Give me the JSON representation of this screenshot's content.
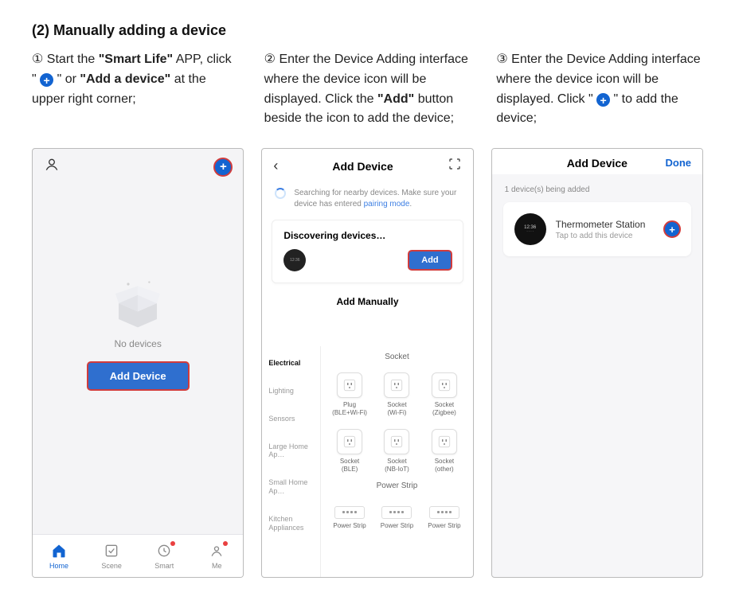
{
  "section_title": "(2) Manually adding a device",
  "steps": {
    "s1": {
      "num": "①",
      "t1": "Start the ",
      "b1": "\"Smart Life\"",
      "t2": " APP, click \" ",
      "t3": " \" or ",
      "b2": "\"Add a device\"",
      "t4": " at the upper right corner;"
    },
    "s2": {
      "num": "②",
      "t1": "Enter the Device Adding interface where the device icon will be displayed. Click the ",
      "b1": "\"Add\"",
      "t2": " button beside the icon to add the device;"
    },
    "s3": {
      "num": "③",
      "t1": "Enter the Device Adding interface where the device icon will be displayed. Click \" ",
      "t2": " \" to add the device;"
    }
  },
  "phone1": {
    "no_devices": "No devices",
    "add_device_btn": "Add Device",
    "nav": [
      "Home",
      "Scene",
      "Smart",
      "Me"
    ]
  },
  "phone2": {
    "title": "Add Device",
    "search_msg1": "Searching for nearby devices. Make sure your device has entered ",
    "pairing": "pairing mode",
    "discovering": "Discovering devices…",
    "add_btn": "Add",
    "add_manually": "Add Manually",
    "categories": [
      "Electrical",
      "Lighting",
      "Sensors",
      "Large Home Ap…",
      "Small Home Ap…",
      "Kitchen Appliances"
    ],
    "socket_head": "Socket",
    "row1": [
      {
        "name": "Plug",
        "sub": "(BLE+Wi-Fi)"
      },
      {
        "name": "Socket",
        "sub": "(Wi-Fi)"
      },
      {
        "name": "Socket",
        "sub": "(Zigbee)"
      }
    ],
    "row2": [
      {
        "name": "Socket",
        "sub": "(BLE)"
      },
      {
        "name": "Socket",
        "sub": "(NB-IoT)"
      },
      {
        "name": "Socket",
        "sub": "(other)"
      }
    ],
    "strip_head": "Power Strip",
    "row3": [
      {
        "name": "Power Strip",
        "sub": ""
      },
      {
        "name": "Power Strip",
        "sub": ""
      },
      {
        "name": "Power Strip",
        "sub": ""
      }
    ]
  },
  "phone3": {
    "title": "Add Device",
    "done": "Done",
    "being_added": "1 device(s) being added",
    "dev_name": "Thermometer Station",
    "dev_sub": "Tap to add this device",
    "dev_time": "12:36"
  }
}
